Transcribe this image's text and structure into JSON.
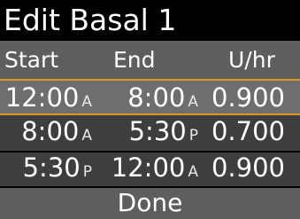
{
  "screen": {
    "title": "Edit Basal 1"
  },
  "table": {
    "headers": {
      "start": "Start",
      "end": "End",
      "rate": "U/hr"
    },
    "rows": [
      {
        "start_time": "12:00",
        "start_suffix": "A",
        "end_time": "8:00",
        "end_suffix": "A",
        "rate": "0.900",
        "selected": true
      },
      {
        "start_time": "8:00",
        "start_suffix": "A",
        "end_time": "5:30",
        "end_suffix": "P",
        "rate": "0.700",
        "selected": false
      },
      {
        "start_time": "5:30",
        "start_suffix": "P",
        "end_time": "12:00",
        "end_suffix": "A",
        "rate": "0.900",
        "selected": false
      }
    ]
  },
  "footer": {
    "done_label": "Done"
  },
  "colors": {
    "selection_border": "#d99a1c",
    "selected_row_bg": "#6e6e6e",
    "row_bg": "#3e3e3e",
    "header_bg": "#5e5e5e"
  }
}
